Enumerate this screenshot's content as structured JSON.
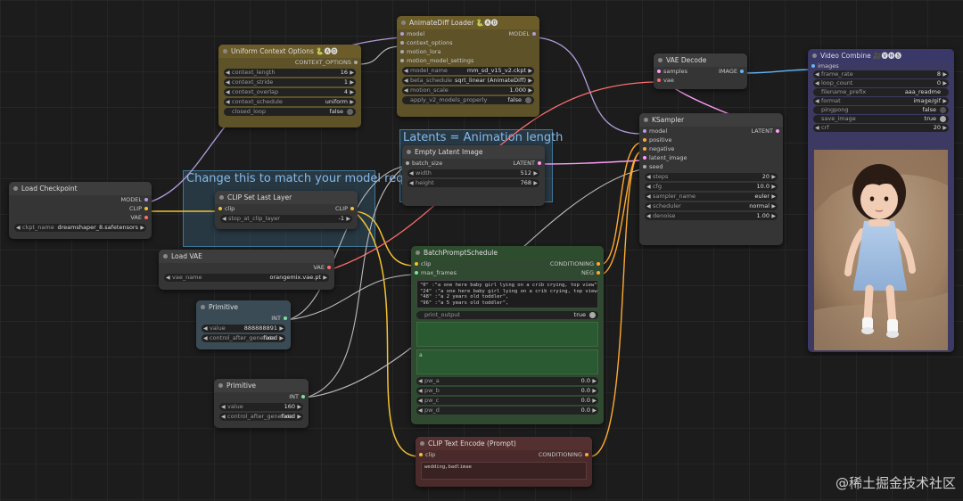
{
  "groups": {
    "latents": "Latents = Animation length",
    "change": "Change this to match your model reqs"
  },
  "nodes": {
    "animatediff": {
      "title": "AnimateDiff Loader 🐍🅐🅓",
      "inputs": [
        "model",
        "context_options",
        "motion_lora",
        "motion_model_settings"
      ],
      "output": "MODEL",
      "widgets": [
        {
          "label": "model_name",
          "value": "mm_sd_v15_v2.ckpt"
        },
        {
          "label": "beta_schedule",
          "value": "sqrt_linear (AnimateDiff)"
        },
        {
          "label": "motion_scale",
          "value": "1.000"
        },
        {
          "label": "apply_v2_models_properly",
          "value": "false"
        }
      ]
    },
    "uniform": {
      "title": "Uniform Context Options 🐍🅐🅓",
      "output": "CONTEXT_OPTIONS",
      "widgets": [
        {
          "label": "context_length",
          "value": "16"
        },
        {
          "label": "context_stride",
          "value": "1"
        },
        {
          "label": "context_overlap",
          "value": "4"
        },
        {
          "label": "context_schedule",
          "value": "uniform"
        },
        {
          "label": "closed_loop",
          "value": "false"
        }
      ]
    },
    "vaedecode": {
      "title": "VAE Decode",
      "inputs": [
        "samples",
        "vae"
      ],
      "output": "IMAGE"
    },
    "videocombine": {
      "title": "Video Combine 🎥🅥🅗🅢",
      "inputs": [
        "images"
      ],
      "widgets": [
        {
          "label": "frame_rate",
          "value": "8"
        },
        {
          "label": "loop_count",
          "value": "0"
        },
        {
          "label": "filename_prefix",
          "value": "aaa_readme"
        },
        {
          "label": "format",
          "value": "image/gif"
        },
        {
          "label": "pingpong",
          "value": "false"
        },
        {
          "label": "save_image",
          "value": "true"
        },
        {
          "label": "crf",
          "value": "20"
        }
      ]
    },
    "ksampler": {
      "title": "KSampler",
      "inputs": [
        "model",
        "positive",
        "negative",
        "latent_image",
        "seed"
      ],
      "output": "LATENT",
      "widgets": [
        {
          "label": "steps",
          "value": "20"
        },
        {
          "label": "cfg",
          "value": "10.0"
        },
        {
          "label": "sampler_name",
          "value": "euler"
        },
        {
          "label": "scheduler",
          "value": "normal"
        },
        {
          "label": "denoise",
          "value": "1.00"
        }
      ]
    },
    "emptylatent": {
      "title": "Empty Latent Image",
      "inputs": [
        "batch_size"
      ],
      "output": "LATENT",
      "widgets": [
        {
          "label": "width",
          "value": "512"
        },
        {
          "label": "height",
          "value": "768"
        }
      ]
    },
    "loadcheckpoint": {
      "title": "Load Checkpoint",
      "outputs": [
        "MODEL",
        "CLIP",
        "VAE"
      ],
      "widgets": [
        {
          "label": "ckpt_name",
          "value": "dreamshaper_8.safetensors"
        }
      ]
    },
    "clipsetlast": {
      "title": "CLIP Set Last Layer",
      "inputs": [
        "clip"
      ],
      "output": "CLIP",
      "widgets": [
        {
          "label": "stop_at_clip_layer",
          "value": "-1"
        }
      ]
    },
    "loadvae": {
      "title": "Load VAE",
      "output": "VAE",
      "widgets": [
        {
          "label": "vae_name",
          "value": "orangemix.vae.pt"
        }
      ]
    },
    "primitive1": {
      "title": "Primitive",
      "output": "INT",
      "widgets": [
        {
          "label": "value",
          "value": "888888891"
        },
        {
          "label": "control_after_generate",
          "value": "fixed"
        }
      ]
    },
    "primitive2": {
      "title": "Primitive",
      "output": "INT",
      "widgets": [
        {
          "label": "value",
          "value": "160"
        },
        {
          "label": "control_after_generate",
          "value": "fixed"
        }
      ]
    },
    "batchprompt": {
      "title": "BatchPromptSchedule",
      "inputs": [
        "clip",
        "max_frames"
      ],
      "outputs": [
        "CONDITIONING",
        "NEG"
      ],
      "text": "\"0\" :\"a one here baby girl lying on a crib crying, top view\",\n\"24\" :\"a one here baby girl lying on a crib crying, top view\",\n\"48\" :\"a 2 years old toddler\",\n\"96\" :\"a 5 years old toddler\",",
      "print_output": {
        "label": "print_output",
        "value": "true"
      },
      "pre_text": "",
      "app_text": "a",
      "widgets": [
        {
          "label": "pw_a",
          "value": "0.0"
        },
        {
          "label": "pw_b",
          "value": "0.0"
        },
        {
          "label": "pw_c",
          "value": "0.0"
        },
        {
          "label": "pw_d",
          "value": "0.0"
        }
      ]
    },
    "cliptextencode": {
      "title": "CLIP Text Encode (Prompt)",
      "inputs": [
        "clip"
      ],
      "output": "CONDITIONING",
      "text": "wedding,badlimae"
    }
  },
  "watermark": "@稀土掘金技术社区",
  "colors": {
    "model": "#b39ddb",
    "clip": "#f2c230",
    "vae": "#ff6e6e",
    "latent": "#ff9cf9",
    "image": "#64b5f6",
    "int": "#aaaaaa",
    "conditioning": "#ffa931"
  }
}
